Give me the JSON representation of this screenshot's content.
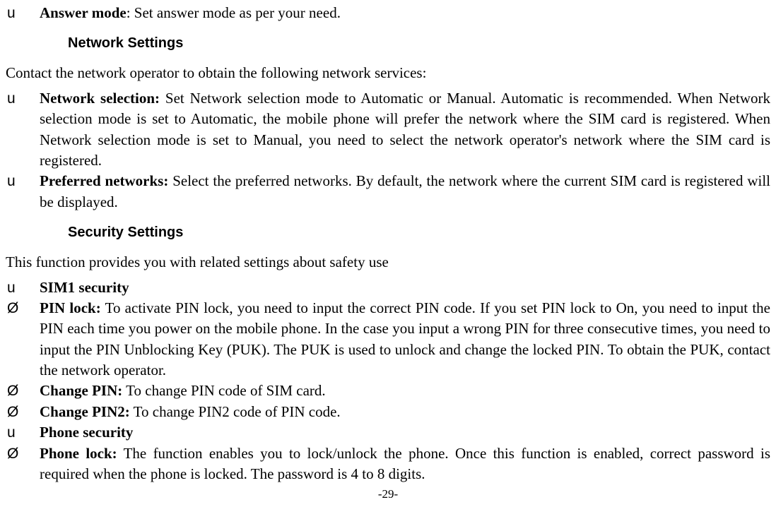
{
  "items": {
    "answer_mode_label": "Answer mode",
    "answer_mode_text": ": Set answer mode as per your need.",
    "heading_network": "Network Settings",
    "network_intro": "Contact the network operator to obtain the following network services:",
    "network_selection_label": "Network selection:",
    "network_selection_text": " Set Network selection mode to Automatic or Manual. Automatic is recommended. When Network selection mode is set to Automatic, the mobile phone will prefer the network where the SIM card is registered. When Network selection mode is set to Manual, you need to select the network operator's network where the SIM card is registered.",
    "preferred_networks_label": "Preferred networks:",
    "preferred_networks_text": " Select the preferred networks. By default, the network where the current SIM card is registered will be displayed.",
    "heading_security": "Security Settings",
    "security_intro": "This function provides you with related settings about safety use",
    "sim1_label": "SIM1 security",
    "pin_lock_label": "PIN lock:",
    "pin_lock_text": " To activate PIN lock, you need to input the correct PIN code. If you set PIN lock to On, you need to input the PIN each time you power on the mobile phone. In the case you input a wrong PIN for three consecutive times, you need to input the PIN Unblocking Key (PUK). The PUK is used to unlock and change the locked PIN. To obtain the PUK, contact the network operator.",
    "change_pin_label": "Change PIN:",
    "change_pin_text": " To change PIN code of SIM card.",
    "change_pin2_label": "Change PIN2:",
    "change_pin2_text": " To change PIN2 code of PIN code.",
    "phone_security_label": "Phone security",
    "phone_lock_label": "Phone lock:",
    "phone_lock_text": " The function enables you to lock/unlock the phone. Once this function is enabled, correct password is required when the phone is locked. The password is 4 to 8 digits.",
    "page_num": "-29-"
  },
  "bullets": {
    "u": "u",
    "o": "Ø"
  }
}
